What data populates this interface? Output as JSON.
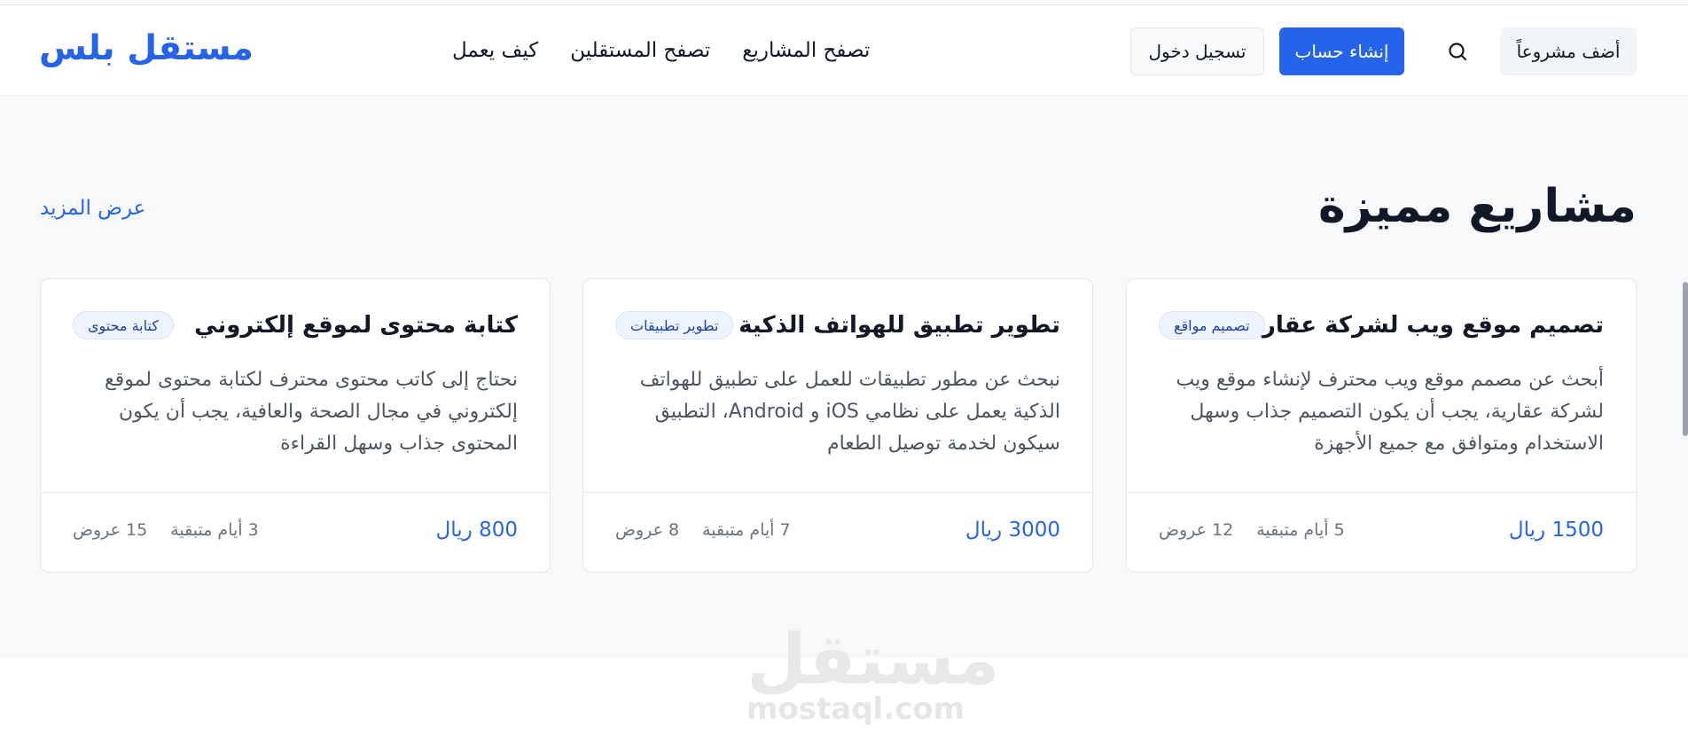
{
  "header": {
    "brand": "مستقل بلس",
    "nav": [
      "كيف يعمل",
      "تصفح المستقلين",
      "تصفح المشاريع"
    ],
    "login_label": "تسجيل دخول",
    "signup_label": "إنشاء حساب",
    "add_project_label": "أضف مشروعاً"
  },
  "section": {
    "title": "مشاريع مميزة",
    "view_more": "عرض المزيد"
  },
  "cards": [
    {
      "title": "تصميم موقع ويب لشركة عقارية",
      "tag": "تصميم مواقع",
      "description": "أبحث عن مصمم موقع ويب محترف لإنشاء موقع ويب لشركة عقارية، يجب أن يكون التصميم جذاب وسهل الاستخدام ومتوافق مع جميع الأجهزة",
      "price": "1500 ريال",
      "offers": "12 عروض",
      "days_left": "5 أيام متبقية"
    },
    {
      "title": "تطوير تطبيق للهواتف الذكية",
      "tag": "تطوير تطبيقات",
      "description": "نبحث عن مطور تطبيقات للعمل على تطبيق للهواتف الذكية يعمل على نظامي iOS و Android، التطبيق سيكون لخدمة توصيل الطعام",
      "price": "3000 ريال",
      "offers": "8 عروض",
      "days_left": "7 أيام متبقية"
    },
    {
      "title": "كتابة محتوى لموقع إلكتروني",
      "tag": "كتابة محتوى",
      "description": "نحتاج إلى كاتب محتوى محترف لكتابة محتوى لموقع إلكتروني في مجال الصحة والعافية، يجب أن يكون المحتوى جذاب وسهل القراءة",
      "price": "800 ريال",
      "offers": "15 عروض",
      "days_left": "3 أيام متبقية"
    }
  ],
  "watermark": {
    "arabic": "مستقل",
    "latin": "mostaql.com"
  },
  "colors": {
    "accent": "#2563eb",
    "section_bg": "#f7f8fa",
    "tag_bg": "#eef4ff"
  }
}
